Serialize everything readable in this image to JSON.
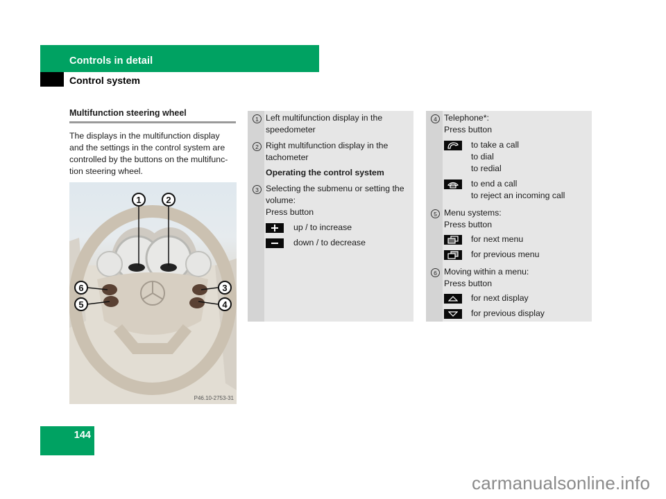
{
  "header": {
    "chapter": "Controls in detail",
    "section": "Control system",
    "brand_color": "#00a262"
  },
  "left_column": {
    "subheading": "Multifunction steering wheel",
    "intro_lines": [
      "The displays in the multifunction display",
      "and the settings in the control system are",
      "controlled by the buttons on the multifunc-",
      "tion steering wheel."
    ],
    "figure": {
      "callouts": [
        "1",
        "2",
        "3",
        "4",
        "5",
        "6"
      ],
      "code": "P46.10-2753-31"
    }
  },
  "middle_panel": {
    "item1": {
      "num": "1",
      "lines": [
        "Left multifunction display in the",
        "speedometer"
      ]
    },
    "item2": {
      "num": "2",
      "lines": [
        "Right multifunction display in the",
        "tachometer"
      ]
    },
    "heading": "Operating the control system",
    "item3": {
      "num": "3",
      "lines": [
        "Selecting the submenu or setting the",
        "volume:",
        "Press button"
      ],
      "buttons": [
        {
          "icon": "plus-button-icon",
          "label": "up / to increase"
        },
        {
          "icon": "minus-button-icon",
          "label": "down / to decrease"
        }
      ]
    }
  },
  "right_panel": {
    "item4": {
      "num": "4",
      "lines": [
        "Telephone*:",
        "Press button"
      ],
      "buttons": [
        {
          "icon": "phone-pickup-icon",
          "lines": [
            "to take a call",
            "to dial",
            "to redial"
          ]
        },
        {
          "icon": "phone-hangup-icon",
          "lines": [
            "to end a call",
            "to reject an incoming call"
          ]
        }
      ]
    },
    "item5": {
      "num": "5",
      "lines": [
        "Menu systems:",
        "Press button"
      ],
      "buttons": [
        {
          "icon": "next-menu-icon",
          "label": "for next menu"
        },
        {
          "icon": "previous-menu-icon",
          "label": "for previous menu"
        }
      ]
    },
    "item6": {
      "num": "6",
      "lines": [
        "Moving within a menu:",
        "Press button"
      ],
      "buttons": [
        {
          "icon": "up-arrow-icon",
          "label": "for next display"
        },
        {
          "icon": "down-arrow-icon",
          "label": "for previous display"
        }
      ]
    }
  },
  "footer": {
    "page_number": "144",
    "watermark": "carmanualsonline.info"
  }
}
